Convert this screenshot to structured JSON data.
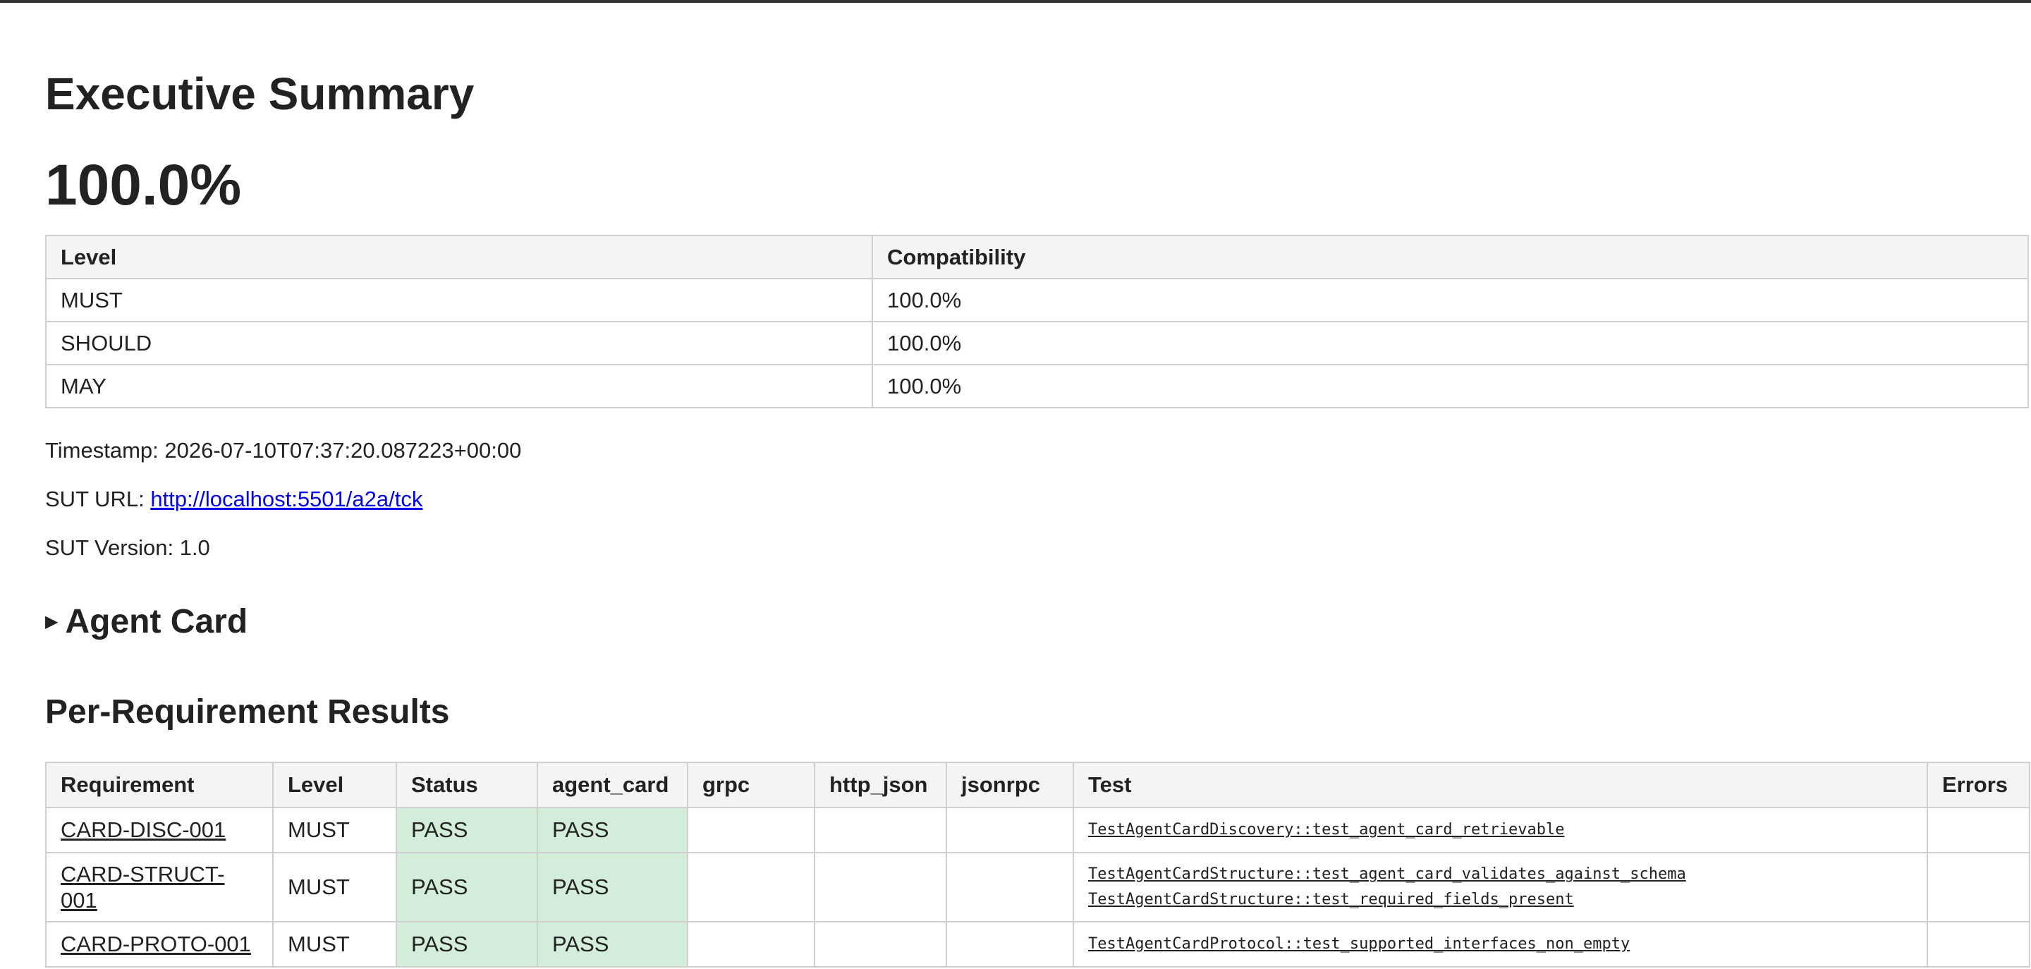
{
  "report": {
    "title": "Executive Summary",
    "overall_score": "100.0%"
  },
  "summary_table": {
    "headers": [
      "Level",
      "Compatibility"
    ],
    "rows": [
      [
        "MUST",
        "100.0%"
      ],
      [
        "SHOULD",
        "100.0%"
      ],
      [
        "MAY",
        "100.0%"
      ]
    ]
  },
  "meta": {
    "timestamp_label": "Timestamp:",
    "timestamp_value": "2026-07-10T07:37:20.087223+00:00",
    "sut_url_label": "SUT URL:",
    "sut_url_value": "http://localhost:5501/a2a/tck",
    "sut_version_label": "SUT Version:",
    "sut_version_value": "1.0"
  },
  "agent_card": {
    "title": "Agent Card",
    "icon": "disclosure-triangle-right-icon"
  },
  "results": {
    "title": "Per-Requirement Results",
    "headers": [
      "Requirement",
      "Level",
      "Status",
      "agent_card",
      "grpc",
      "http_json",
      "jsonrpc",
      "Test",
      "Errors"
    ],
    "rows": [
      {
        "requirement": "CARD-DISC-001",
        "level": "MUST",
        "status": "PASS",
        "agent_card": "PASS",
        "grpc": "",
        "http_json": "",
        "jsonrpc": "",
        "tests": [
          "TestAgentCardDiscovery::test_agent_card_retrievable"
        ],
        "errors": ""
      },
      {
        "requirement": "CARD-STRUCT-001",
        "level": "MUST",
        "status": "PASS",
        "agent_card": "PASS",
        "grpc": "",
        "http_json": "",
        "jsonrpc": "",
        "tests": [
          "TestAgentCardStructure::test_agent_card_validates_against_schema",
          "TestAgentCardStructure::test_required_fields_present"
        ],
        "errors": ""
      },
      {
        "requirement": "CARD-PROTO-001",
        "level": "MUST",
        "status": "PASS",
        "agent_card": "PASS",
        "grpc": "",
        "http_json": "",
        "jsonrpc": "",
        "tests": [
          "TestAgentCardProtocol::test_supported_interfaces_non_empty"
        ],
        "errors": ""
      }
    ]
  },
  "colors": {
    "pass_background": "#d4edda",
    "link": "#0000ee",
    "header_background": "#f4f4f4",
    "border": "#d0d0d0"
  }
}
